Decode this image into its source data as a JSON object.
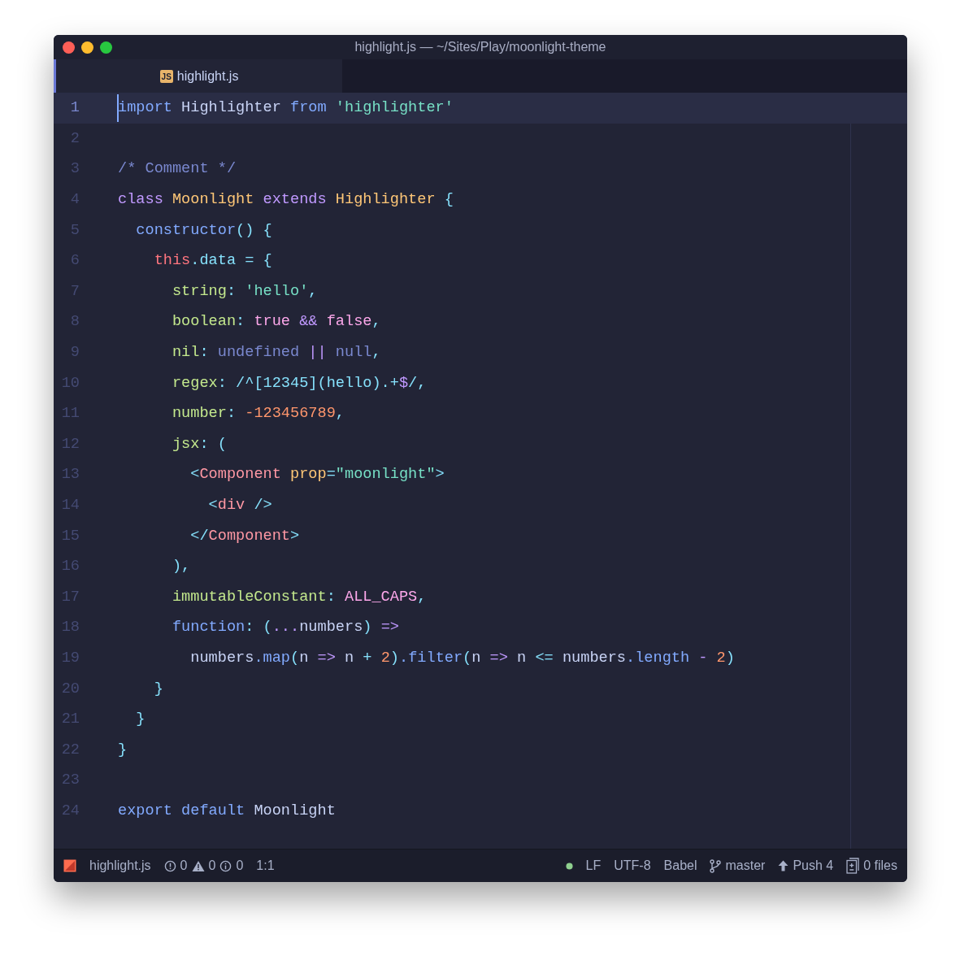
{
  "window": {
    "title": "highlight.js — ~/Sites/Play/moonlight-theme"
  },
  "tabs": [
    {
      "label": "highlight.js",
      "icon": "JS",
      "selected": true
    }
  ],
  "editor": {
    "lines": [
      {
        "number": "1",
        "current": true,
        "tokens": [
          {
            "kind": "kw",
            "text": "import "
          },
          {
            "kind": "text",
            "text": "Highlighter "
          },
          {
            "kind": "kw",
            "text": "from "
          },
          {
            "kind": "str",
            "text": "'highlighter'"
          }
        ]
      },
      {
        "number": "2",
        "current": false
      },
      {
        "number": "3",
        "current": false,
        "tokens": [
          {
            "kind": "comment",
            "text": "/* Comment */"
          }
        ]
      },
      {
        "number": "4",
        "current": false,
        "tokens": [
          {
            "kind": "kw2",
            "text": "class "
          },
          {
            "kind": "cls",
            "text": "Moonlight "
          },
          {
            "kind": "kw2",
            "text": "extends "
          },
          {
            "kind": "cls",
            "text": "Highlighter "
          },
          {
            "kind": "punc",
            "text": "{"
          }
        ]
      },
      {
        "number": "5",
        "current": false,
        "tokens": [
          {
            "kind": "fn",
            "text": "  constructor"
          },
          {
            "kind": "punc",
            "text": "() {"
          }
        ]
      },
      {
        "number": "6",
        "current": false,
        "tokens": [
          {
            "kind": "this",
            "text": "    this"
          },
          {
            "kind": "punc",
            "text": ".data = {"
          }
        ]
      },
      {
        "number": "7",
        "current": false,
        "tokens": [
          {
            "kind": "prop",
            "text": "      string"
          },
          {
            "kind": "punc",
            "text": ": "
          },
          {
            "kind": "str",
            "text": "'hello'"
          },
          {
            "kind": "punc",
            "text": ","
          }
        ]
      },
      {
        "number": "8",
        "current": false,
        "tokens": [
          {
            "kind": "prop",
            "text": "      boolean"
          },
          {
            "kind": "punc",
            "text": ": "
          },
          {
            "kind": "bool",
            "text": "true "
          },
          {
            "kind": "op",
            "text": "&& "
          },
          {
            "kind": "bool",
            "text": "false"
          },
          {
            "kind": "punc",
            "text": ","
          }
        ]
      },
      {
        "number": "9",
        "current": false,
        "tokens": [
          {
            "kind": "prop",
            "text": "      nil"
          },
          {
            "kind": "punc",
            "text": ": "
          },
          {
            "kind": "nil",
            "text": "undefined "
          },
          {
            "kind": "op",
            "text": "|| "
          },
          {
            "kind": "nil",
            "text": "null"
          },
          {
            "kind": "punc",
            "text": ","
          }
        ]
      },
      {
        "number": "10",
        "current": false,
        "tokens": [
          {
            "kind": "prop",
            "text": "      regex"
          },
          {
            "kind": "punc",
            "text": ": /^[12345](hello).+"
          },
          {
            "kind": "op",
            "text": "$"
          },
          {
            "kind": "punc",
            "text": "/,"
          }
        ]
      },
      {
        "number": "11",
        "current": false,
        "tokens": [
          {
            "kind": "prop",
            "text": "      number"
          },
          {
            "kind": "punc",
            "text": ": "
          },
          {
            "kind": "num",
            "text": "-123456789"
          },
          {
            "kind": "punc",
            "text": ","
          }
        ]
      },
      {
        "number": "12",
        "current": false,
        "tokens": [
          {
            "kind": "prop",
            "text": "      jsx"
          },
          {
            "kind": "punc",
            "text": ": ("
          }
        ]
      },
      {
        "number": "13",
        "current": false,
        "tokens": [
          {
            "kind": "punc",
            "text": "        <"
          },
          {
            "kind": "tag",
            "text": "Component "
          },
          {
            "kind": "attr",
            "text": "prop"
          },
          {
            "kind": "punc",
            "text": "="
          },
          {
            "kind": "str",
            "text": "\"moonlight\""
          },
          {
            "kind": "punc",
            "text": ">"
          }
        ]
      },
      {
        "number": "14",
        "current": false,
        "tokens": [
          {
            "kind": "punc",
            "text": "          <"
          },
          {
            "kind": "tag",
            "text": "div "
          },
          {
            "kind": "punc",
            "text": "/>"
          }
        ]
      },
      {
        "number": "15",
        "current": false,
        "tokens": [
          {
            "kind": "punc",
            "text": "        </"
          },
          {
            "kind": "tag",
            "text": "Component"
          },
          {
            "kind": "punc",
            "text": ">"
          }
        ]
      },
      {
        "number": "16",
        "current": false,
        "tokens": [
          {
            "kind": "punc",
            "text": "      ),"
          }
        ]
      },
      {
        "number": "17",
        "current": false,
        "tokens": [
          {
            "kind": "prop",
            "text": "      immutableConstant"
          },
          {
            "kind": "punc",
            "text": ": "
          },
          {
            "kind": "const",
            "text": "ALL_CAPS"
          },
          {
            "kind": "punc",
            "text": ","
          }
        ]
      },
      {
        "number": "18",
        "current": false,
        "tokens": [
          {
            "kind": "fn",
            "text": "      function"
          },
          {
            "kind": "punc",
            "text": ": ("
          },
          {
            "kind": "op",
            "text": "..."
          },
          {
            "kind": "text",
            "text": "numbers"
          },
          {
            "kind": "punc",
            "text": ") "
          },
          {
            "kind": "op",
            "text": "=>"
          }
        ]
      },
      {
        "number": "19",
        "current": false,
        "tokens": [
          {
            "kind": "text",
            "text": "        numbers"
          },
          {
            "kind": "fn",
            "text": ".map"
          },
          {
            "kind": "punc",
            "text": "("
          },
          {
            "kind": "text",
            "text": "n "
          },
          {
            "kind": "op",
            "text": "=> "
          },
          {
            "kind": "text",
            "text": "n "
          },
          {
            "kind": "punc",
            "text": "+ "
          },
          {
            "kind": "num",
            "text": "2"
          },
          {
            "kind": "punc",
            "text": ")"
          },
          {
            "kind": "fn",
            "text": ".filter"
          },
          {
            "kind": "punc",
            "text": "("
          },
          {
            "kind": "text",
            "text": "n "
          },
          {
            "kind": "op",
            "text": "=> "
          },
          {
            "kind": "text",
            "text": "n "
          },
          {
            "kind": "punc",
            "text": "<= "
          },
          {
            "kind": "text",
            "text": "numbers"
          },
          {
            "kind": "fn",
            "text": ".length "
          },
          {
            "kind": "op",
            "text": "- "
          },
          {
            "kind": "num",
            "text": "2"
          },
          {
            "kind": "punc",
            "text": ")"
          }
        ]
      },
      {
        "number": "20",
        "current": false,
        "tokens": [
          {
            "kind": "punc",
            "text": "    }"
          }
        ]
      },
      {
        "number": "21",
        "current": false,
        "tokens": [
          {
            "kind": "punc",
            "text": "  }"
          }
        ]
      },
      {
        "number": "22",
        "current": false,
        "tokens": [
          {
            "kind": "punc",
            "text": "}"
          }
        ]
      },
      {
        "number": "23",
        "current": false
      },
      {
        "number": "24",
        "current": false,
        "tokens": [
          {
            "kind": "kw",
            "text": "export default "
          },
          {
            "kind": "text",
            "text": "Moonlight"
          }
        ]
      }
    ]
  },
  "status_bar": {
    "file": "highlight.js",
    "errors": "0",
    "warnings": "0",
    "infos": "0",
    "cursor": "1:1",
    "line_ending": "LF",
    "encoding": "UTF-8",
    "grammar": "Babel",
    "branch": "master",
    "push": "Push 4",
    "files": "0 files"
  }
}
